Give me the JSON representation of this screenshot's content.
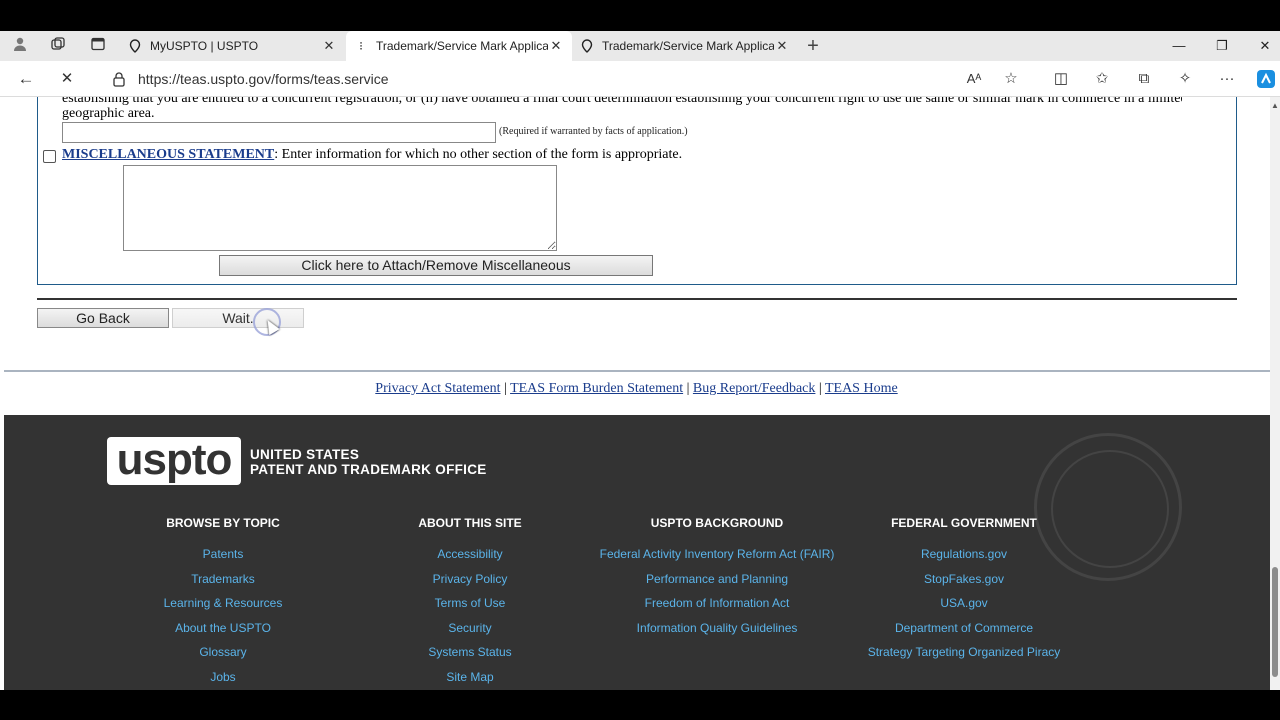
{
  "browser": {
    "tabs": [
      {
        "title": "MyUSPTO | USPTO",
        "active": false
      },
      {
        "title": "Trademark/Service Mark Applicat",
        "active": true
      },
      {
        "title": "Trademark/Service Mark Applicat",
        "active": false
      }
    ],
    "url": "https://teas.uspto.gov/forms/teas.service"
  },
  "form": {
    "cut_text_line1": "establishing that you are entitled to a concurrent registration, or (ii) have obtained a final court determination establishing your concurrent right to use the same or similar mark in commerce in a limited",
    "cut_text_line2": "geographic area.",
    "concurrent_value": "",
    "required_note": "(Required if warranted by facts of application.)",
    "misc_link": "MISCELLANEOUS STATEMENT",
    "misc_desc": ": Enter information for which no other section of the form is appropriate.",
    "misc_checked": false,
    "misc_value": "",
    "attach_button": "Click here to Attach/Remove Miscellaneous",
    "go_back": "Go Back",
    "wait": "Wait."
  },
  "page_links": {
    "privacy": "Privacy Act Statement",
    "burden": "TEAS Form Burden Statement",
    "bug": "Bug Report/Feedback",
    "home": "TEAS Home",
    "separator": "|"
  },
  "footer": {
    "logo": "uspto",
    "logo_line1": "UNITED STATES",
    "logo_line2": "PATENT AND TRADEMARK OFFICE",
    "columns": [
      {
        "heading": "BROWSE BY TOPIC",
        "links": [
          "Patents",
          "Trademarks",
          "Learning & Resources",
          "About the USPTO",
          "Glossary",
          "Jobs"
        ]
      },
      {
        "heading": "ABOUT THIS SITE",
        "links": [
          "Accessibility",
          "Privacy Policy",
          "Terms of Use",
          "Security",
          "Systems Status",
          "Site Map"
        ]
      },
      {
        "heading": "USPTO BACKGROUND",
        "links": [
          "Federal Activity Inventory Reform Act (FAIR)",
          "Performance and Planning",
          "Freedom of Information Act",
          "Information Quality Guidelines"
        ]
      },
      {
        "heading": "FEDERAL GOVERNMENT",
        "links": [
          "Regulations.gov",
          "StopFakes.gov",
          "USA.gov",
          "Department of Commerce",
          "Strategy Targeting Organized Piracy"
        ]
      }
    ]
  }
}
